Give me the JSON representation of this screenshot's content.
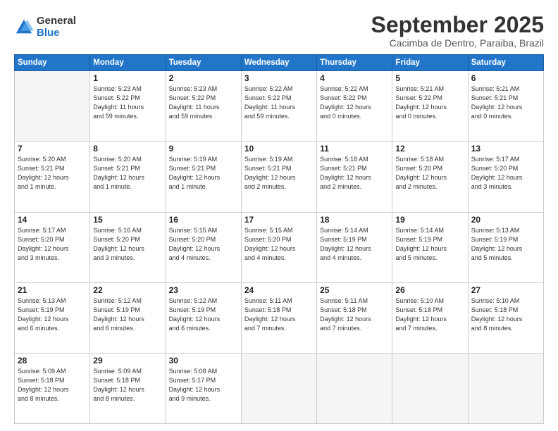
{
  "logo": {
    "general": "General",
    "blue": "Blue"
  },
  "header": {
    "month_title": "September 2025",
    "subtitle": "Cacimba de Dentro, Paraiba, Brazil"
  },
  "weekdays": [
    "Sunday",
    "Monday",
    "Tuesday",
    "Wednesday",
    "Thursday",
    "Friday",
    "Saturday"
  ],
  "weeks": [
    [
      {
        "day": "",
        "info": ""
      },
      {
        "day": "1",
        "info": "Sunrise: 5:23 AM\nSunset: 5:22 PM\nDaylight: 11 hours\nand 59 minutes."
      },
      {
        "day": "2",
        "info": "Sunrise: 5:23 AM\nSunset: 5:22 PM\nDaylight: 11 hours\nand 59 minutes."
      },
      {
        "day": "3",
        "info": "Sunrise: 5:22 AM\nSunset: 5:22 PM\nDaylight: 11 hours\nand 59 minutes."
      },
      {
        "day": "4",
        "info": "Sunrise: 5:22 AM\nSunset: 5:22 PM\nDaylight: 12 hours\nand 0 minutes."
      },
      {
        "day": "5",
        "info": "Sunrise: 5:21 AM\nSunset: 5:22 PM\nDaylight: 12 hours\nand 0 minutes."
      },
      {
        "day": "6",
        "info": "Sunrise: 5:21 AM\nSunset: 5:21 PM\nDaylight: 12 hours\nand 0 minutes."
      }
    ],
    [
      {
        "day": "7",
        "info": "Sunrise: 5:20 AM\nSunset: 5:21 PM\nDaylight: 12 hours\nand 1 minute."
      },
      {
        "day": "8",
        "info": "Sunrise: 5:20 AM\nSunset: 5:21 PM\nDaylight: 12 hours\nand 1 minute."
      },
      {
        "day": "9",
        "info": "Sunrise: 5:19 AM\nSunset: 5:21 PM\nDaylight: 12 hours\nand 1 minute."
      },
      {
        "day": "10",
        "info": "Sunrise: 5:19 AM\nSunset: 5:21 PM\nDaylight: 12 hours\nand 2 minutes."
      },
      {
        "day": "11",
        "info": "Sunrise: 5:18 AM\nSunset: 5:21 PM\nDaylight: 12 hours\nand 2 minutes."
      },
      {
        "day": "12",
        "info": "Sunrise: 5:18 AM\nSunset: 5:20 PM\nDaylight: 12 hours\nand 2 minutes."
      },
      {
        "day": "13",
        "info": "Sunrise: 5:17 AM\nSunset: 5:20 PM\nDaylight: 12 hours\nand 3 minutes."
      }
    ],
    [
      {
        "day": "14",
        "info": "Sunrise: 5:17 AM\nSunset: 5:20 PM\nDaylight: 12 hours\nand 3 minutes."
      },
      {
        "day": "15",
        "info": "Sunrise: 5:16 AM\nSunset: 5:20 PM\nDaylight: 12 hours\nand 3 minutes."
      },
      {
        "day": "16",
        "info": "Sunrise: 5:15 AM\nSunset: 5:20 PM\nDaylight: 12 hours\nand 4 minutes."
      },
      {
        "day": "17",
        "info": "Sunrise: 5:15 AM\nSunset: 5:20 PM\nDaylight: 12 hours\nand 4 minutes."
      },
      {
        "day": "18",
        "info": "Sunrise: 5:14 AM\nSunset: 5:19 PM\nDaylight: 12 hours\nand 4 minutes."
      },
      {
        "day": "19",
        "info": "Sunrise: 5:14 AM\nSunset: 5:19 PM\nDaylight: 12 hours\nand 5 minutes."
      },
      {
        "day": "20",
        "info": "Sunrise: 5:13 AM\nSunset: 5:19 PM\nDaylight: 12 hours\nand 5 minutes."
      }
    ],
    [
      {
        "day": "21",
        "info": "Sunrise: 5:13 AM\nSunset: 5:19 PM\nDaylight: 12 hours\nand 6 minutes."
      },
      {
        "day": "22",
        "info": "Sunrise: 5:12 AM\nSunset: 5:19 PM\nDaylight: 12 hours\nand 6 minutes."
      },
      {
        "day": "23",
        "info": "Sunrise: 5:12 AM\nSunset: 5:19 PM\nDaylight: 12 hours\nand 6 minutes."
      },
      {
        "day": "24",
        "info": "Sunrise: 5:11 AM\nSunset: 5:18 PM\nDaylight: 12 hours\nand 7 minutes."
      },
      {
        "day": "25",
        "info": "Sunrise: 5:11 AM\nSunset: 5:18 PM\nDaylight: 12 hours\nand 7 minutes."
      },
      {
        "day": "26",
        "info": "Sunrise: 5:10 AM\nSunset: 5:18 PM\nDaylight: 12 hours\nand 7 minutes."
      },
      {
        "day": "27",
        "info": "Sunrise: 5:10 AM\nSunset: 5:18 PM\nDaylight: 12 hours\nand 8 minutes."
      }
    ],
    [
      {
        "day": "28",
        "info": "Sunrise: 5:09 AM\nSunset: 5:18 PM\nDaylight: 12 hours\nand 8 minutes."
      },
      {
        "day": "29",
        "info": "Sunrise: 5:09 AM\nSunset: 5:18 PM\nDaylight: 12 hours\nand 8 minutes."
      },
      {
        "day": "30",
        "info": "Sunrise: 5:08 AM\nSunset: 5:17 PM\nDaylight: 12 hours\nand 9 minutes."
      },
      {
        "day": "",
        "info": ""
      },
      {
        "day": "",
        "info": ""
      },
      {
        "day": "",
        "info": ""
      },
      {
        "day": "",
        "info": ""
      }
    ]
  ]
}
